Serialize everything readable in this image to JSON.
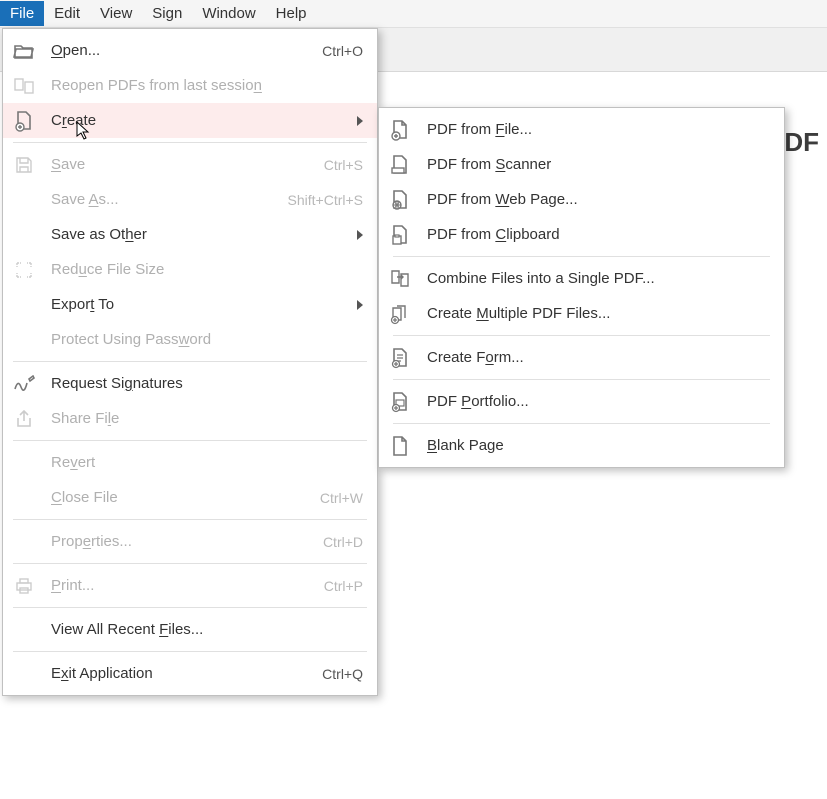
{
  "menubar": {
    "file": "File",
    "edit": "Edit",
    "view": "View",
    "sign": "Sign",
    "window": "Window",
    "help": "Help"
  },
  "bg": {
    "pdf_label": "PDF"
  },
  "file_menu": {
    "open": {
      "pre": "",
      "u": "O",
      "post": "pen...",
      "shortcut": "Ctrl+O"
    },
    "reopen": {
      "pre": "Reopen PDFs from last sessio",
      "u": "n",
      "post": ""
    },
    "create": {
      "pre": "C",
      "u": "r",
      "post": "eate"
    },
    "save": {
      "pre": "",
      "u": "S",
      "post": "ave",
      "shortcut": "Ctrl+S"
    },
    "save_as": {
      "pre": "Save ",
      "u": "A",
      "post": "s...",
      "shortcut": "Shift+Ctrl+S"
    },
    "save_other": {
      "pre": "Save as Ot",
      "u": "h",
      "post": "er"
    },
    "reduce": {
      "pre": "Red",
      "u": "u",
      "post": "ce File Size"
    },
    "export": {
      "pre": "Expor",
      "u": "t",
      "post": " To"
    },
    "protect": {
      "pre": "Protect Using Pass",
      "u": "w",
      "post": "ord"
    },
    "signatures": {
      "pre": "Request Si",
      "u": "g",
      "post": "natures"
    },
    "share": {
      "pre": "Share Fi",
      "u": "l",
      "post": "e"
    },
    "revert": {
      "pre": "Re",
      "u": "v",
      "post": "ert"
    },
    "close": {
      "pre": "",
      "u": "C",
      "post": "lose File",
      "shortcut": "Ctrl+W"
    },
    "properties": {
      "pre": "Prop",
      "u": "e",
      "post": "rties...",
      "shortcut": "Ctrl+D"
    },
    "print": {
      "pre": "",
      "u": "P",
      "post": "rint...",
      "shortcut": "Ctrl+P"
    },
    "recent": {
      "pre": "View All Recent ",
      "u": "F",
      "post": "iles..."
    },
    "exit": {
      "pre": "E",
      "u": "x",
      "post": "it Application",
      "shortcut": "Ctrl+Q"
    }
  },
  "create_menu": {
    "from_file": {
      "pre": "PDF from ",
      "u": "F",
      "post": "ile..."
    },
    "from_scanner": {
      "pre": "PDF from ",
      "u": "S",
      "post": "canner"
    },
    "from_web": {
      "pre": "PDF from ",
      "u": "W",
      "post": "eb Page..."
    },
    "from_clipboard": {
      "pre": "PDF from ",
      "u": "C",
      "post": "lipboard"
    },
    "combine": {
      "pre": "Combine Files into a Single PDF",
      "u": "",
      "post": "..."
    },
    "multiple": {
      "pre": "Create ",
      "u": "M",
      "post": "ultiple PDF Files..."
    },
    "form": {
      "pre": "Create F",
      "u": "o",
      "post": "rm..."
    },
    "portfolio": {
      "pre": "PDF ",
      "u": "P",
      "post": "ortfolio..."
    },
    "blank": {
      "pre": "",
      "u": "B",
      "post": "lank Page"
    }
  }
}
